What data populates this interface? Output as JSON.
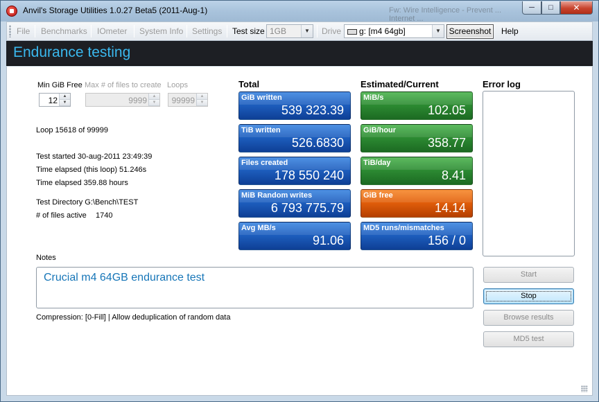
{
  "window": {
    "title": "Anvil's Storage Utilities 1.0.27 Beta5 (2011-Aug-1)",
    "background_window_text": "Fw: Wire Intelligence - Prevent ... Internet ..."
  },
  "window_controls": {
    "minimize": "─",
    "maximize": "□",
    "close": "✕"
  },
  "menu": {
    "file": "File",
    "benchmarks": "Benchmarks",
    "iometer": "IOmeter",
    "system_info": "System Info",
    "settings": "Settings",
    "test_size_label": "Test size",
    "test_size_value": "1GB",
    "drive_label": "Drive",
    "drive_value": "g: [m4 64gb]",
    "screenshot": "Screenshot",
    "help": "Help"
  },
  "page_title": "Endurance testing",
  "settings": {
    "min_free_label": "Min GiB Free",
    "min_free_value": "12",
    "max_files_label": "Max # of files to create",
    "max_files_value": "9999",
    "loops_label": "Loops",
    "loops_value": "99999"
  },
  "status": {
    "loop": "Loop 15618 of 99999",
    "test_started": "Test started 30-aug-2011 23:49:39",
    "elapsed_loop": "Time elapsed (this loop) 51.246s",
    "elapsed_total": "Time elapsed 359.88 hours",
    "test_directory": "Test Directory G:\\Bench\\TEST",
    "files_active_label": "# of files active",
    "files_active_value": "1740"
  },
  "totals": {
    "heading": "Total",
    "tiles": [
      {
        "label": "GiB written",
        "value": "539 323.39",
        "color": "blue"
      },
      {
        "label": "TiB written",
        "value": "526.6830",
        "color": "blue"
      },
      {
        "label": "Files created",
        "value": "178 550 240",
        "color": "blue"
      },
      {
        "label": "MiB Random writes",
        "value": "6 793 775.79",
        "color": "blue"
      },
      {
        "label": "Avg MB/s",
        "value": "91.06",
        "color": "blue"
      }
    ]
  },
  "estimated": {
    "heading": "Estimated/Current",
    "tiles": [
      {
        "label": "MiB/s",
        "value": "102.05",
        "color": "green"
      },
      {
        "label": "GiB/hour",
        "value": "358.77",
        "color": "green"
      },
      {
        "label": "TiB/day",
        "value": "8.41",
        "color": "green"
      },
      {
        "label": "GiB free",
        "value": "14.14",
        "color": "orange"
      },
      {
        "label": "MD5 runs/mismatches",
        "value": "156 / 0",
        "color": "blue"
      }
    ]
  },
  "error_log": {
    "heading": "Error log"
  },
  "notes": {
    "label": "Notes",
    "text": "Crucial m4 64GB endurance test"
  },
  "compression": "Compression: [0-Fill]  |  Allow deduplication of random data",
  "buttons": {
    "start": "Start",
    "stop": "Stop",
    "browse": "Browse results",
    "md5": "MD5 test"
  },
  "colors": {
    "header_band": "#1d1f24",
    "header_text": "#3ab8ee",
    "tile_blue": "#1e5fbf",
    "tile_green": "#2d8c33",
    "tile_orange": "#e25f0b",
    "notes_text": "#1776b8"
  }
}
